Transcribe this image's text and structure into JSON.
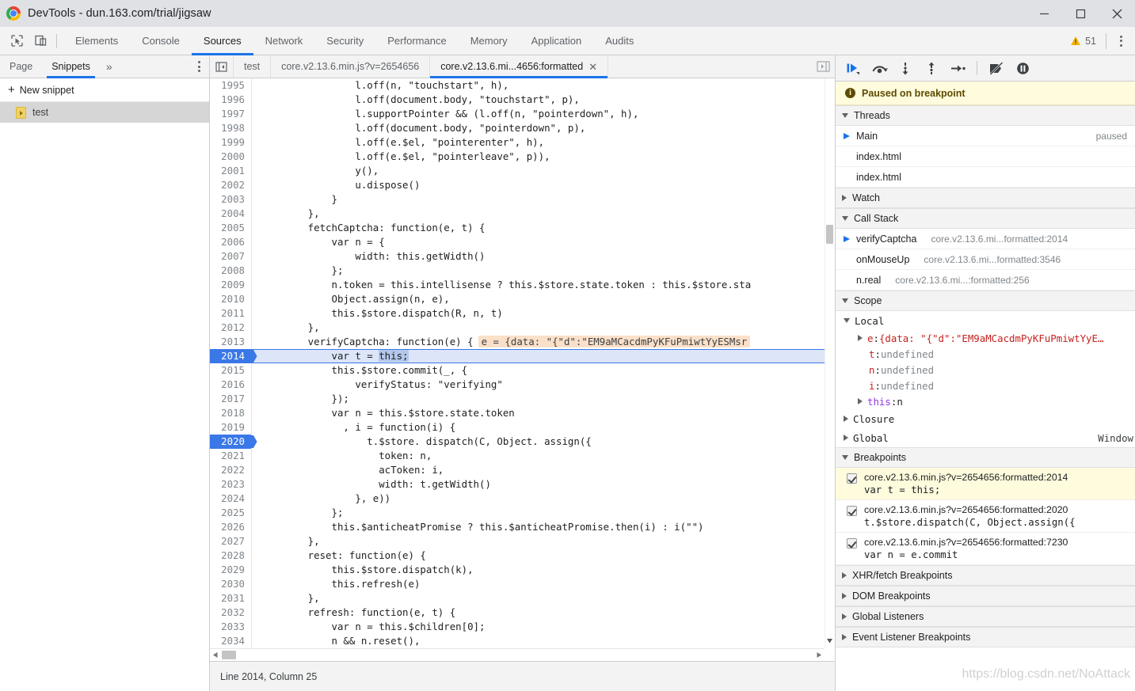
{
  "window": {
    "title": "DevTools - dun.163.com/trial/jigsaw",
    "controls": {
      "minimize": "minimize-icon",
      "maximize": "maximize-icon",
      "close": "close-icon"
    }
  },
  "main_toolbar": {
    "icons": [
      "inspect-element-icon",
      "device-toolbar-icon"
    ],
    "tabs": [
      {
        "label": "Elements",
        "active": false
      },
      {
        "label": "Console",
        "active": false
      },
      {
        "label": "Sources",
        "active": true
      },
      {
        "label": "Network",
        "active": false
      },
      {
        "label": "Security",
        "active": false
      },
      {
        "label": "Performance",
        "active": false
      },
      {
        "label": "Memory",
        "active": false
      },
      {
        "label": "Application",
        "active": false
      },
      {
        "label": "Audits",
        "active": false
      }
    ],
    "warning_count": "51",
    "warning_color": "#f5b400",
    "more_label": "more-options-icon"
  },
  "navigator": {
    "tabs": [
      {
        "label": "Page",
        "active": false
      },
      {
        "label": "Snippets",
        "active": true
      }
    ],
    "more_glyph": "»",
    "new_snippet": "New snippet",
    "items": [
      {
        "label": "test",
        "selected": true,
        "icon": "snippet-file-icon"
      }
    ]
  },
  "editor": {
    "tabs": [
      {
        "label": "test",
        "active": false,
        "closable": false
      },
      {
        "label": "core.v2.13.6.min.js?v=2654656",
        "active": false,
        "closable": false
      },
      {
        "label": "core.v2.13.6.mi...4656:formatted",
        "active": true,
        "closable": true
      }
    ],
    "close_glyph": "✕",
    "status": "Line 2014, Column 25",
    "inline_value": "e = {data: \"{\"d\":\"EM9aMCacdmPyKFuPmiwtYyESMsr",
    "lines": [
      {
        "n": "1995",
        "code": "                l.off(n, \"touchstart\", h),"
      },
      {
        "n": "1996",
        "code": "                l.off(document.body, \"touchstart\", p),"
      },
      {
        "n": "1997",
        "code": "                l.supportPointer && (l.off(n, \"pointerdown\", h),"
      },
      {
        "n": "1998",
        "code": "                l.off(document.body, \"pointerdown\", p),"
      },
      {
        "n": "1999",
        "code": "                l.off(e.$el, \"pointerenter\", h),"
      },
      {
        "n": "2000",
        "code": "                l.off(e.$el, \"pointerleave\", p)),"
      },
      {
        "n": "2001",
        "code": "                y(),"
      },
      {
        "n": "2002",
        "code": "                u.dispose()"
      },
      {
        "n": "2003",
        "code": "            }"
      },
      {
        "n": "2004",
        "code": "        },"
      },
      {
        "n": "2005",
        "code": "        fetchCaptcha: function(e, t) {"
      },
      {
        "n": "2006",
        "code": "            var n = {"
      },
      {
        "n": "2007",
        "code": "                width: this.getWidth()"
      },
      {
        "n": "2008",
        "code": "            };"
      },
      {
        "n": "2009",
        "code": "            n.token = this.intellisense ? this.$store.state.token : this.$store.sta"
      },
      {
        "n": "2010",
        "code": "            Object.assign(n, e),"
      },
      {
        "n": "2011",
        "code": "            this.$store.dispatch(R, n, t)"
      },
      {
        "n": "2012",
        "code": "        },"
      },
      {
        "n": "2013",
        "code": "        verifyCaptcha: function(e) {",
        "has_inline_value": true
      },
      {
        "n": "2014",
        "code": "            var t = this;",
        "breakpoint": true,
        "executing": true,
        "selection": "this;"
      },
      {
        "n": "2015",
        "code": "            this.$store.commit(_, {"
      },
      {
        "n": "2016",
        "code": "                verifyStatus: \"verifying\""
      },
      {
        "n": "2017",
        "code": "            });"
      },
      {
        "n": "2018",
        "code": "            var n = this.$store.state.token"
      },
      {
        "n": "2019",
        "code": "              , i = function(i) {"
      },
      {
        "n": "2020",
        "code": "                  t.$store. dispatch(C, Object. assign({",
        "breakpoint": true,
        "chips": true
      },
      {
        "n": "2021",
        "code": "                    token: n,"
      },
      {
        "n": "2022",
        "code": "                    acToken: i,"
      },
      {
        "n": "2023",
        "code": "                    width: t.getWidth()"
      },
      {
        "n": "2024",
        "code": "                }, e))"
      },
      {
        "n": "2025",
        "code": "            };"
      },
      {
        "n": "2026",
        "code": "            this.$anticheatPromise ? this.$anticheatPromise.then(i) : i(\"\")"
      },
      {
        "n": "2027",
        "code": "        },"
      },
      {
        "n": "2028",
        "code": "        reset: function(e) {"
      },
      {
        "n": "2029",
        "code": "            this.$store.dispatch(k),"
      },
      {
        "n": "2030",
        "code": "            this.refresh(e)"
      },
      {
        "n": "2031",
        "code": "        },"
      },
      {
        "n": "2032",
        "code": "        refresh: function(e, t) {"
      },
      {
        "n": "2033",
        "code": "            var n = this.$children[0];"
      },
      {
        "n": "2034",
        "code": "            n && n.reset(),"
      },
      {
        "n": "2035",
        "code": ""
      }
    ]
  },
  "debugger": {
    "toolbar_buttons": [
      "resume-script-execution-icon",
      "step-over-next-function-call-icon",
      "step-into-next-function-call-icon",
      "step-out-of-current-function-icon",
      "step-icon",
      "deactivate-breakpoints-icon",
      "pause-on-exceptions-icon"
    ],
    "paused_banner": "Paused on breakpoint",
    "threads": {
      "title": "Threads",
      "expanded": true,
      "items": [
        {
          "label": "Main",
          "status": "paused",
          "current": true
        },
        {
          "label": "index.html",
          "status": "",
          "current": false
        },
        {
          "label": "index.html",
          "status": "",
          "current": false
        }
      ]
    },
    "watch": {
      "title": "Watch",
      "expanded": false
    },
    "call_stack": {
      "title": "Call Stack",
      "expanded": true,
      "frames": [
        {
          "fn": "verifyCaptcha",
          "src": "core.v2.13.6.mi...formatted:2014",
          "current": true
        },
        {
          "fn": "onMouseUp",
          "src": "core.v2.13.6.mi...formatted:3546",
          "current": false
        },
        {
          "fn": "n.real",
          "src": "core.v2.13.6.mi...:formatted:256",
          "current": false
        }
      ]
    },
    "scope": {
      "title": "Scope",
      "expanded": true,
      "local_label": "Local",
      "vars": [
        {
          "name": "e",
          "sep": ": ",
          "value": "{data: \"{\"d\":\"EM9aMCacdmPyKFuPmiwtYyE…",
          "type": "object",
          "expandable": true
        },
        {
          "name": "t",
          "sep": ": ",
          "value": "undefined",
          "type": "undefined",
          "expandable": false
        },
        {
          "name": "n",
          "sep": ": ",
          "value": "undefined",
          "type": "undefined",
          "expandable": false
        },
        {
          "name": "i",
          "sep": ": ",
          "value": "undefined",
          "type": "undefined",
          "expandable": false
        },
        {
          "name": "this",
          "sep": ": ",
          "value": "n",
          "type": "this",
          "expandable": true
        }
      ],
      "closure_label": "Closure",
      "global_label": "Global",
      "global_value": "Window"
    },
    "breakpoints": {
      "title": "Breakpoints",
      "expanded": true,
      "items": [
        {
          "checked": true,
          "location": "core.v2.13.6.min.js?v=2654656:formatted:2014",
          "code": "var t = this;",
          "active": true
        },
        {
          "checked": true,
          "location": "core.v2.13.6.min.js?v=2654656:formatted:2020",
          "code": "t.$store.dispatch(C, Object.assign({",
          "active": false
        },
        {
          "checked": true,
          "location": "core.v2.13.6.min.js?v=2654656:formatted:7230",
          "code": "var n = e.commit",
          "active": false
        }
      ]
    },
    "other_sections": [
      {
        "title": "XHR/fetch Breakpoints",
        "expanded": false
      },
      {
        "title": "DOM Breakpoints",
        "expanded": false
      },
      {
        "title": "Global Listeners",
        "expanded": false
      },
      {
        "title": "Event Listener Breakpoints",
        "expanded": false
      }
    ]
  },
  "watermark": "https://blog.csdn.net/NoAttack"
}
